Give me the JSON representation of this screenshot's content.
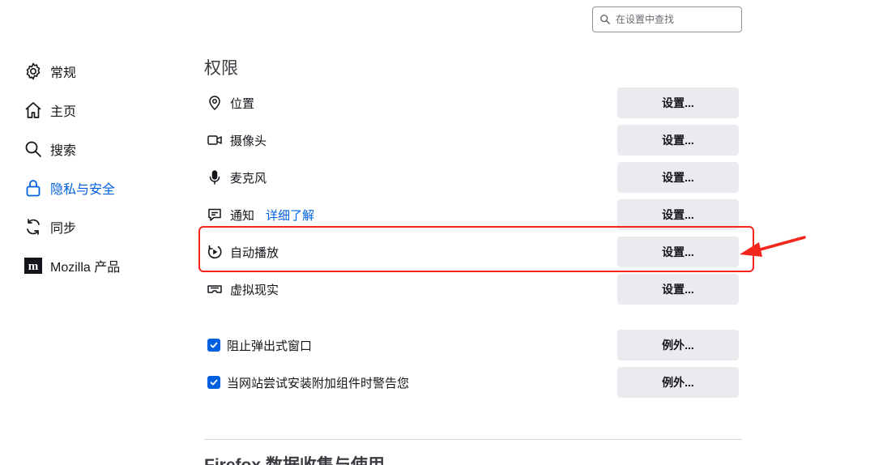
{
  "search": {
    "placeholder": "在设置中查找"
  },
  "sidebar": {
    "items": [
      {
        "label": "常规",
        "icon": "gear-icon",
        "active": false
      },
      {
        "label": "主页",
        "icon": "home-icon",
        "active": false
      },
      {
        "label": "搜索",
        "icon": "search-icon",
        "active": false
      },
      {
        "label": "隐私与安全",
        "icon": "lock-icon",
        "active": true
      },
      {
        "label": "同步",
        "icon": "sync-icon",
        "active": false
      },
      {
        "label": "Mozilla 产品",
        "icon": "mozilla-icon",
        "active": false
      }
    ]
  },
  "permissions": {
    "title": "权限",
    "rows": [
      {
        "label": "位置",
        "icon": "location-pin-icon",
        "button": "设置..."
      },
      {
        "label": "摄像头",
        "icon": "camera-icon",
        "button": "设置..."
      },
      {
        "label": "麦克风",
        "icon": "microphone-icon",
        "button": "设置..."
      },
      {
        "label": "通知",
        "icon": "notification-icon",
        "link": "详细了解",
        "button": "设置..."
      },
      {
        "label": "自动播放",
        "icon": "autoplay-icon",
        "button": "设置..."
      },
      {
        "label": "虚拟现实",
        "icon": "vr-headset-icon",
        "button": "设置..."
      }
    ],
    "checks": [
      {
        "label": "阻止弹出式窗口",
        "checked": true,
        "button": "例外..."
      },
      {
        "label": "当网站尝试安装附加组件时警告您",
        "checked": true,
        "button": "例外..."
      }
    ]
  },
  "next_section": {
    "title": "Firefox 数据收集与使用"
  },
  "colors": {
    "accent": "#0061e0",
    "annotation": "#f2261b",
    "button_bg": "#ebebef"
  }
}
